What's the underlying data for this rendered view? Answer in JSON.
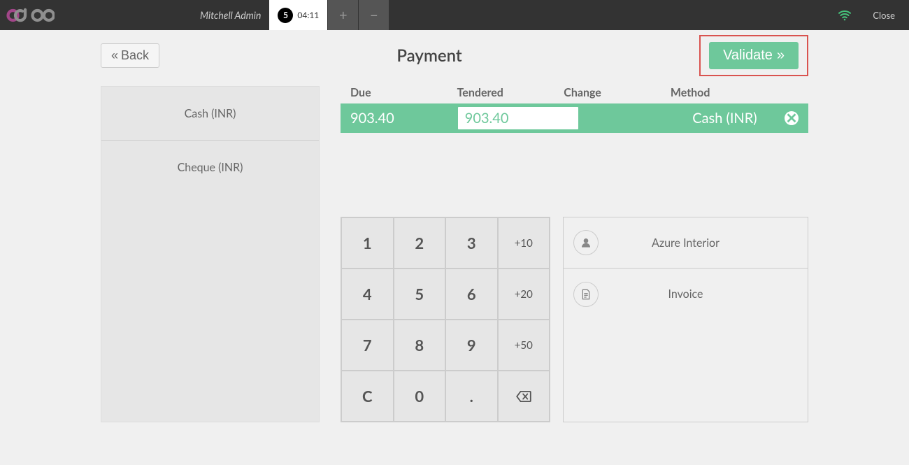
{
  "topbar": {
    "user": "Mitchell Admin",
    "order_number": "5",
    "order_time": "04:11",
    "close": "Close"
  },
  "header": {
    "back": "Back",
    "title": "Payment",
    "validate": "Validate"
  },
  "payment_methods": [
    "Cash (INR)",
    "Cheque (INR)"
  ],
  "columns": {
    "due": "Due",
    "tendered": "Tendered",
    "change": "Change",
    "method": "Method"
  },
  "payment_line": {
    "due": "903.40",
    "tendered": "903.40",
    "change": "",
    "method": "Cash (INR)"
  },
  "keypad": {
    "keys": [
      "1",
      "2",
      "3",
      "+10",
      "4",
      "5",
      "6",
      "+20",
      "7",
      "8",
      "9",
      "+50",
      "C",
      "0",
      ".",
      "⌫"
    ]
  },
  "side": {
    "customer": "Azure Interior",
    "invoice": "Invoice"
  }
}
